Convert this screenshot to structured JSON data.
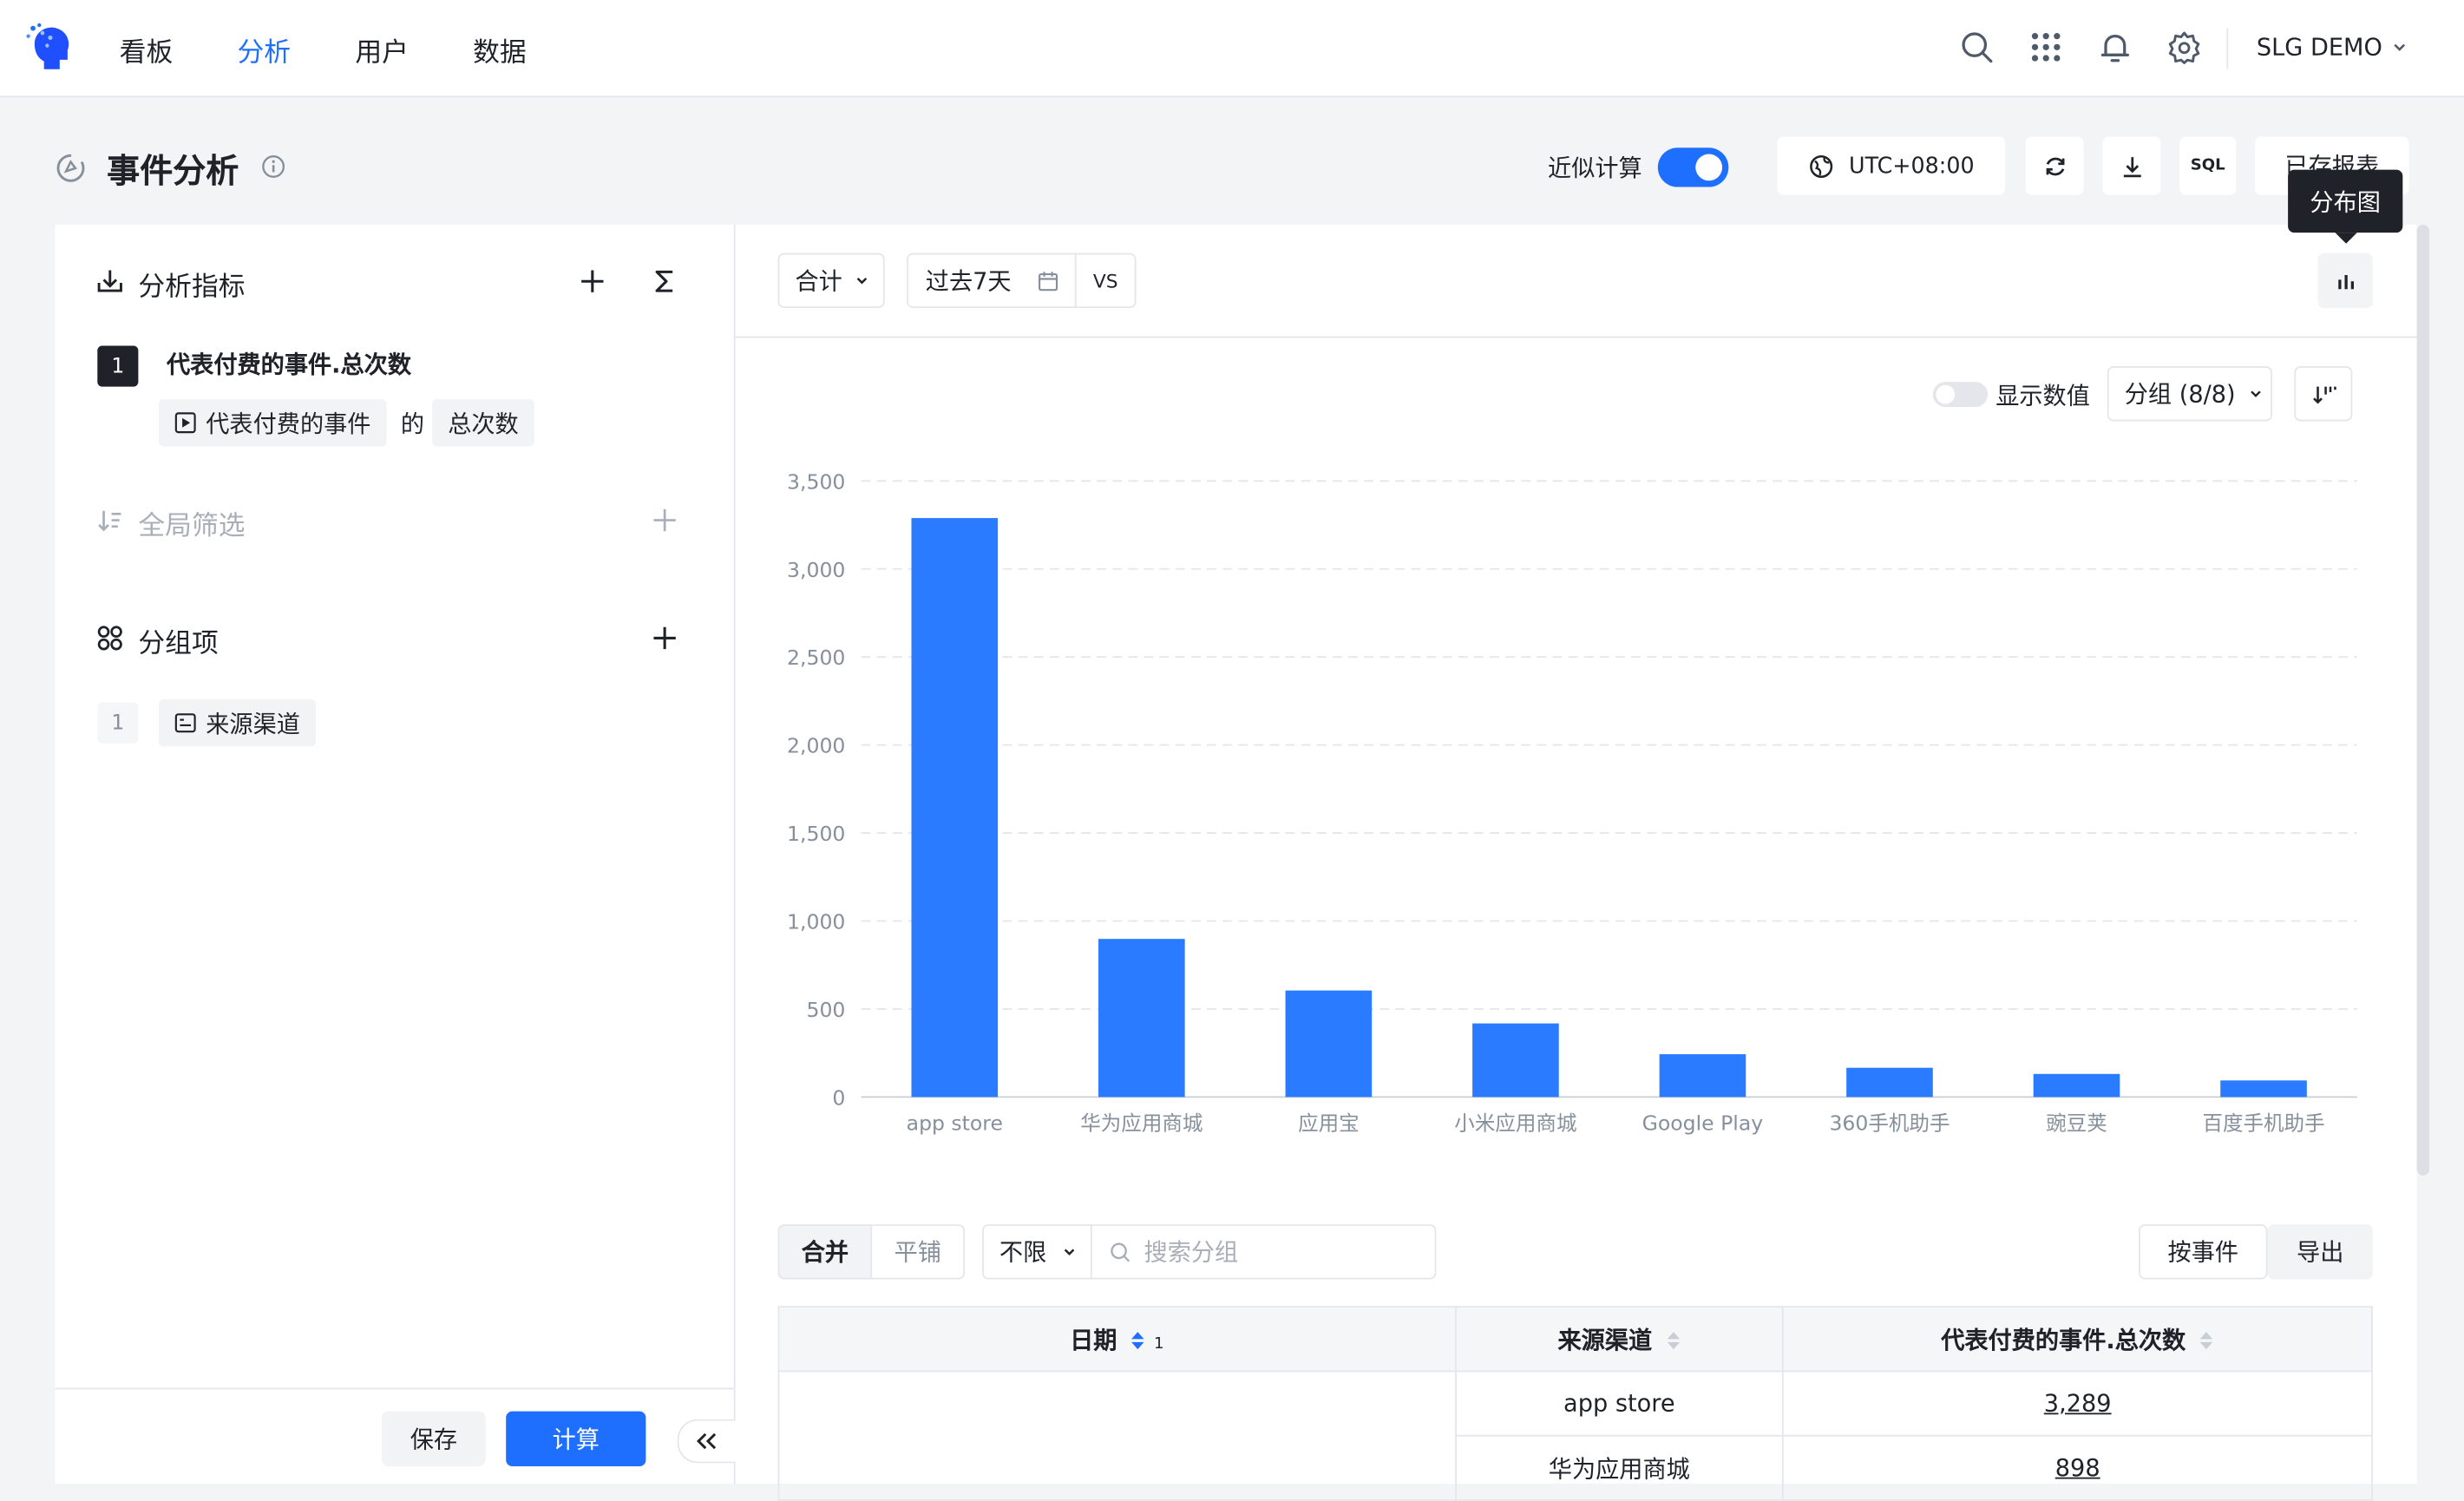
{
  "nav": {
    "items": [
      "看板",
      "分析",
      "用户",
      "数据"
    ],
    "active_index": 1,
    "user": "SLG DEMO",
    "icons": [
      "search-icon",
      "apps-grid-icon",
      "bell-icon",
      "gear-icon"
    ]
  },
  "header": {
    "title": "事件分析",
    "approx_label": "近似计算",
    "approx_on": true,
    "timezone": "UTC+08:00",
    "sql_label": "SQL",
    "saved_reports": "已存报表"
  },
  "left": {
    "metrics_title": "分析指标",
    "metric_index": "1",
    "metric_name": "代表付费的事件.总次数",
    "metric_event": "代表付费的事件",
    "metric_of": "的",
    "metric_agg": "总次数",
    "filter_title": "全局筛选",
    "group_title": "分组项",
    "group_index": "1",
    "group_field": "来源渠道",
    "save": "保存",
    "calc": "计算",
    "collapse": "«"
  },
  "toolbar": {
    "agg": "合计",
    "date_range": "过去7天",
    "vs": "VS",
    "chart_tooltip": "分布图",
    "show_values": "显示数值",
    "group_select": "分组 (8/8)"
  },
  "chart_data": {
    "type": "bar",
    "categories": [
      "app store",
      "华为应用商城",
      "应用宝",
      "小米应用商城",
      "Google Play",
      "360手机助手",
      "豌豆荚",
      "百度手机助手"
    ],
    "values": [
      3289,
      898,
      605,
      418,
      243,
      166,
      131,
      94
    ],
    "y_ticks": [
      "0",
      "500",
      "1,000",
      "1,500",
      "2,000",
      "2,500",
      "3,000",
      "3,500"
    ],
    "ylim": [
      0,
      3500
    ],
    "grid": true,
    "bar_color": "#2a7bff"
  },
  "table_controls": {
    "merge": "合并",
    "tile": "平铺",
    "limit": "不限",
    "search_placeholder": "搜索分组",
    "by_event": "按事件",
    "export": "导出"
  },
  "table": {
    "headers": [
      "日期",
      "来源渠道",
      "代表付费的事件.总次数"
    ],
    "sort_index": "1",
    "rows": [
      {
        "channel": "app store",
        "value": "3,289"
      },
      {
        "channel": "华为应用商城",
        "value": "898"
      }
    ]
  }
}
